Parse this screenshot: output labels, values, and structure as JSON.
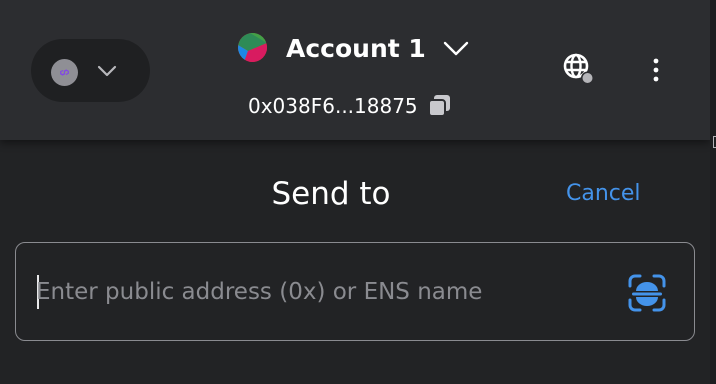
{
  "header": {
    "network_icon": "polygon-icon",
    "account_name": "Account 1",
    "account_address": "0x038F6...18875",
    "icons": {
      "chevron": "chevron-down-icon",
      "copy": "copy-icon",
      "globe": "globe-connected-icon",
      "menu": "kebab-menu-icon"
    }
  },
  "send": {
    "title": "Send to",
    "cancel_label": "Cancel",
    "address_placeholder": "Enter public address (0x) or ENS name",
    "address_value": "",
    "scan_icon": "qr-scan-icon"
  },
  "colors": {
    "background": "#222325",
    "header": "#2c2d30",
    "accent": "#4493ea",
    "text": "#ffffff",
    "muted": "#8a8b90",
    "network_badge": "#8247e5"
  }
}
